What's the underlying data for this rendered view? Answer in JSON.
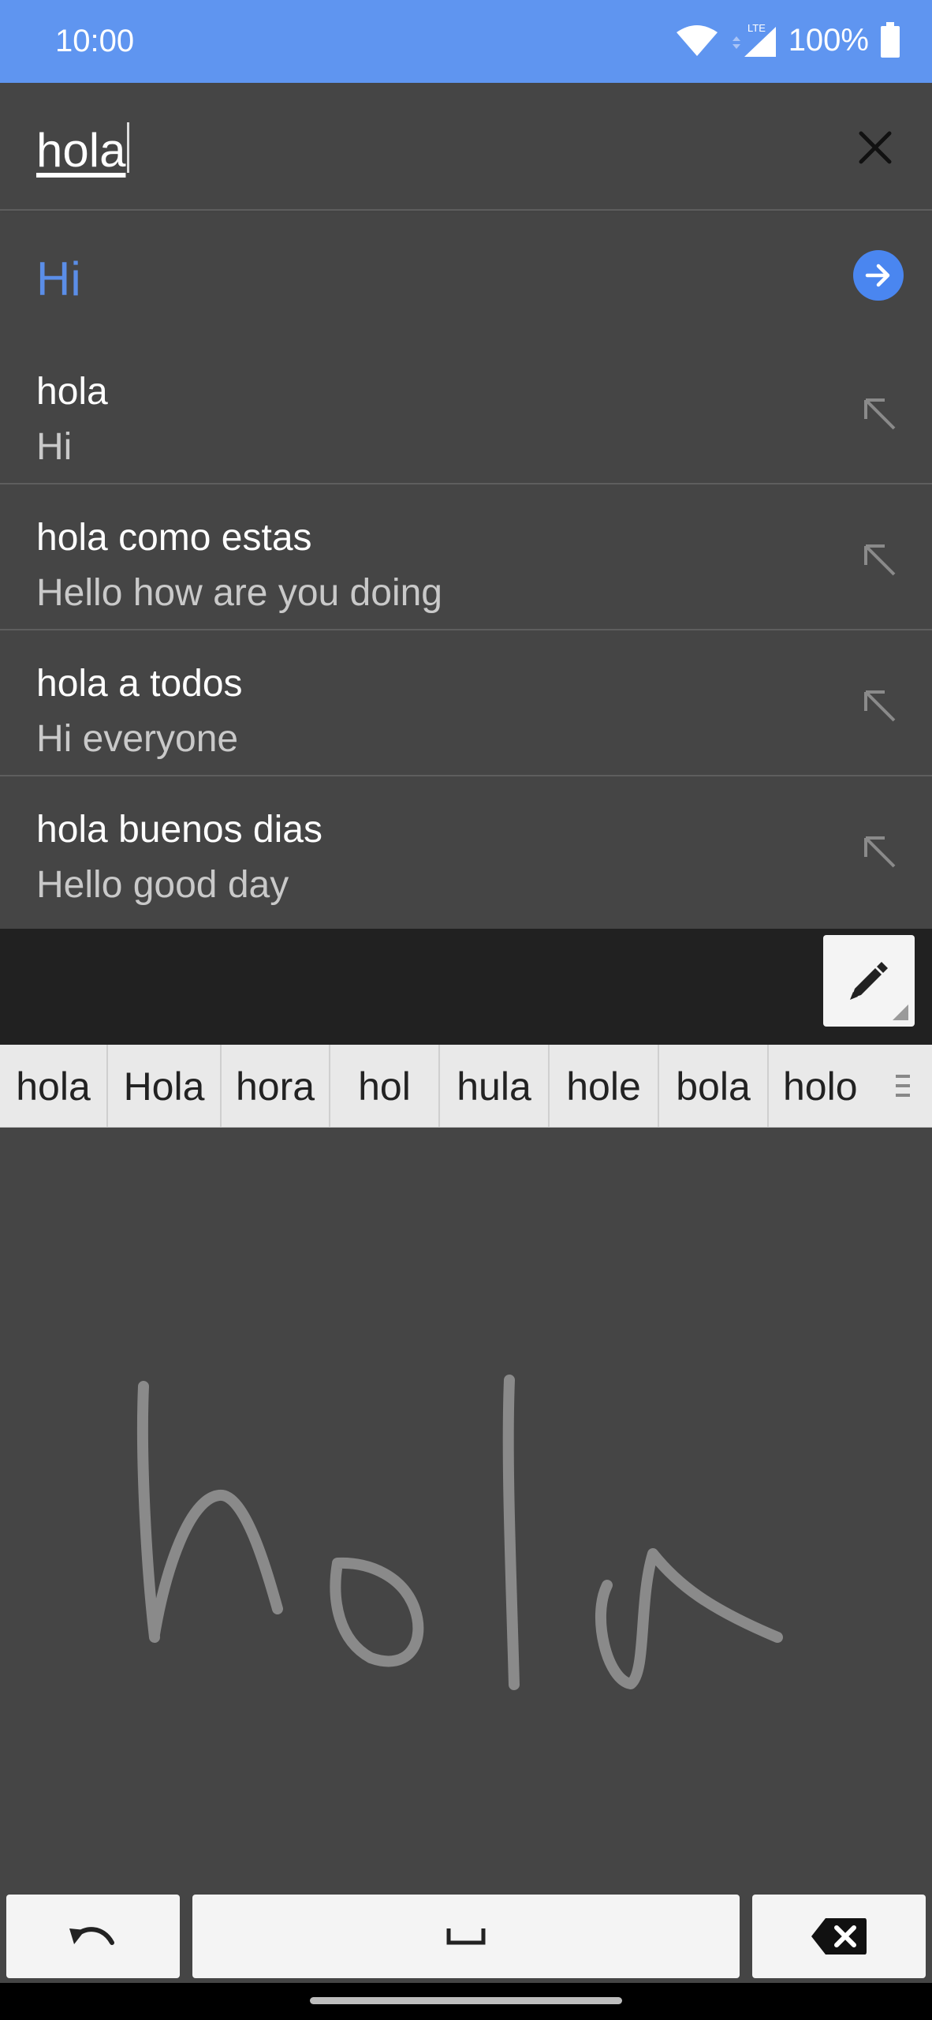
{
  "status_bar": {
    "time": "10:00",
    "network": "LTE",
    "battery": "100%",
    "icons": [
      "wifi-icon",
      "signal-icon",
      "battery-icon"
    ]
  },
  "search": {
    "value": "hola",
    "close_icon": "close-icon"
  },
  "translation": {
    "text": "Hi",
    "action_icon": "arrow-right-icon"
  },
  "suggestions": [
    {
      "source": "hola",
      "translation": "Hi",
      "icon": "north-west-arrow-icon"
    },
    {
      "source": "hola como estas",
      "translation": "Hello how are you doing",
      "icon": "north-west-arrow-icon"
    },
    {
      "source": "hola a todos",
      "translation": "Hi everyone",
      "icon": "north-west-arrow-icon"
    },
    {
      "source": "hola buenos dias",
      "translation": "Hello good day",
      "icon": "north-west-arrow-icon"
    }
  ],
  "handwriting": {
    "pen_icon": "pen-icon",
    "candidates": [
      "hola",
      "Hola",
      "hora",
      "hol",
      "hula",
      "hole",
      "bola",
      "holo"
    ],
    "more_icon": "more-candidates-icon"
  },
  "keys": {
    "undo_icon": "undo-icon",
    "space_icon": "space-icon",
    "backspace_icon": "backspace-icon"
  },
  "colors": {
    "status_bar": "#5f95f0",
    "accent": "#4a86f0",
    "translation_text": "#5b8ee8",
    "background": "#454545"
  }
}
